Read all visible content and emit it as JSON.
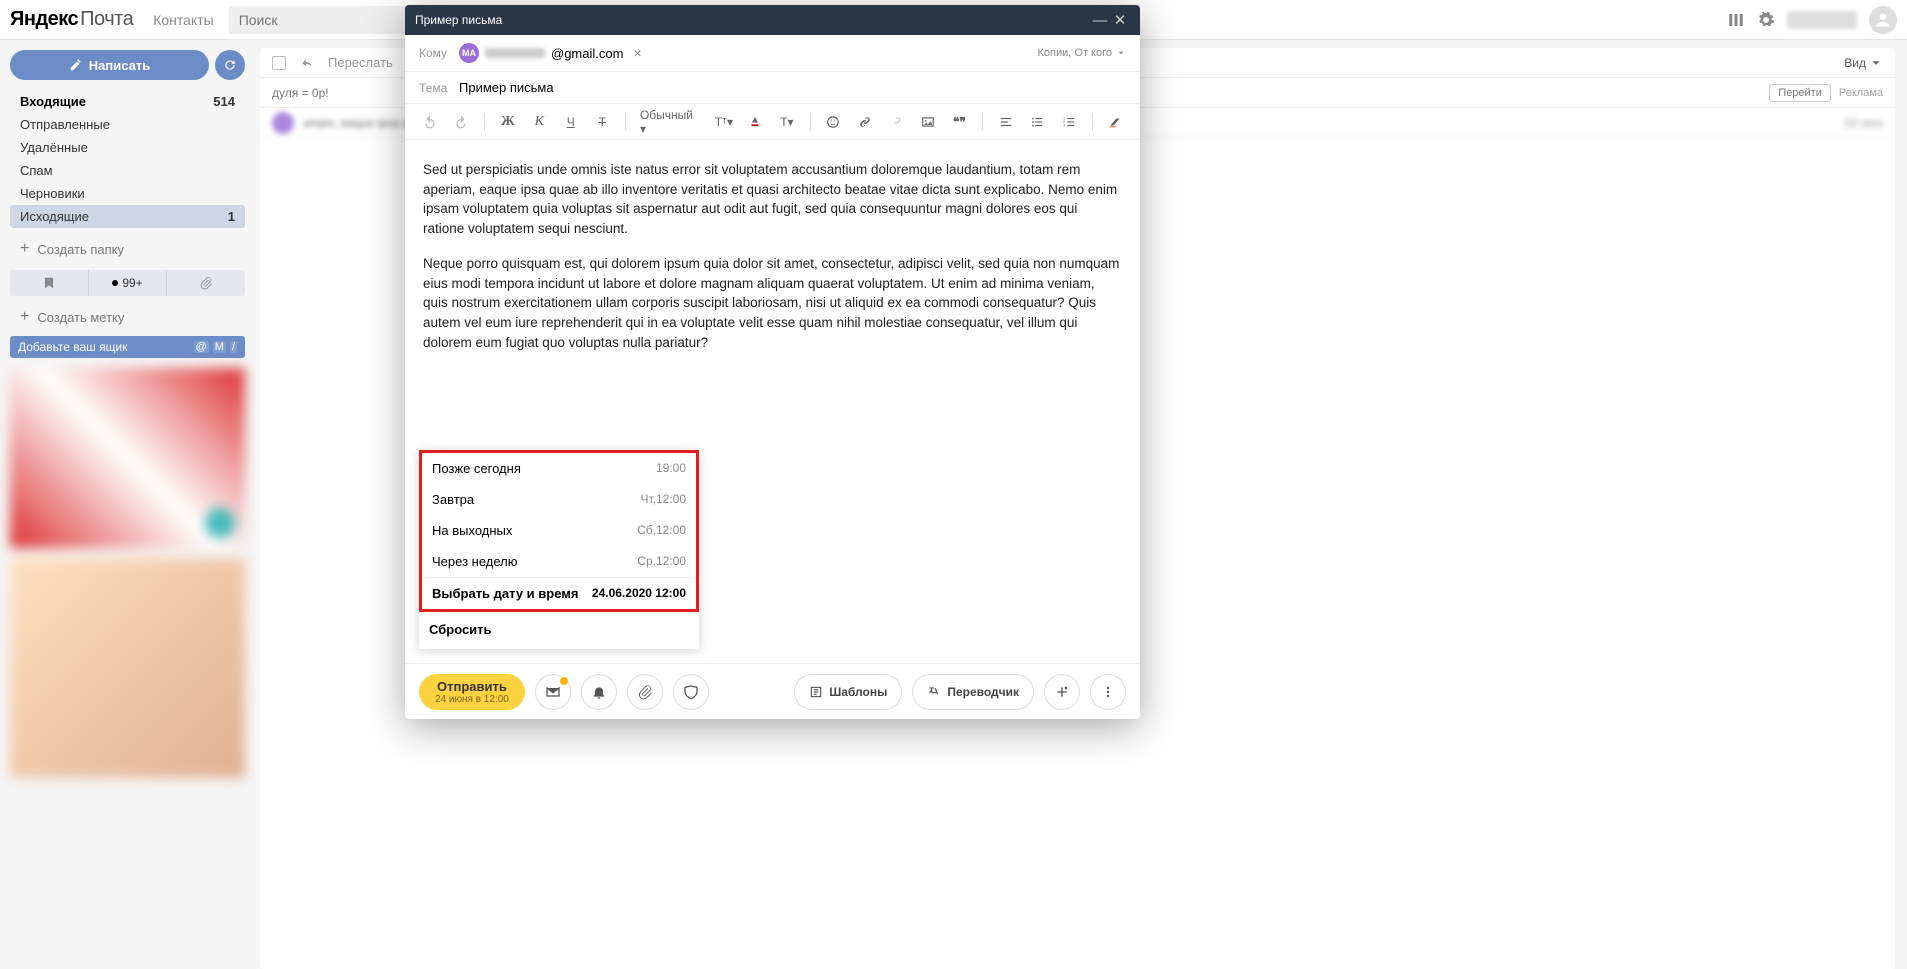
{
  "top": {
    "logo_ya": "Яндекс",
    "logo_sub": "Почта",
    "contacts": "Контакты",
    "search_placeholder": "Поиск"
  },
  "sidebar": {
    "compose": "Написать",
    "folders": [
      {
        "label": "Входящие",
        "count": "514",
        "bold": true,
        "sel": false
      },
      {
        "label": "Отправленные",
        "count": "",
        "bold": false,
        "sel": false
      },
      {
        "label": "Удалённые",
        "count": "",
        "bold": false,
        "sel": false
      },
      {
        "label": "Спам",
        "count": "",
        "bold": false,
        "sel": false
      },
      {
        "label": "Черновики",
        "count": "",
        "bold": false,
        "sel": false
      },
      {
        "label": "Исходящие",
        "count": "1",
        "bold": false,
        "sel": true
      }
    ],
    "create_folder": "Создать папку",
    "unread_badge": "99+",
    "create_label": "Создать метку",
    "add_box": "Добавьте ваш ящик",
    "add_box_icons": [
      "@",
      "M",
      "/"
    ]
  },
  "list": {
    "forward": "Переслать",
    "view": "Вид",
    "promo_text": "дуля = 0р!",
    "promo_go": "Перейти",
    "promo_ad": "Реклама",
    "msg_preview": "eriam, eaque ipsa quae ab illo inventore veritatis et quasi architecto b...",
    "msg_date": "24 июн"
  },
  "compose": {
    "title": "Пример письма",
    "to_label": "Кому",
    "to_initials": "MA",
    "to_suffix": "@gmail.com",
    "cc_label": "Копии, От кого",
    "subject_label": "Тема",
    "subject_value": "Пример письма",
    "style_normal": "Обычный",
    "body_p1": "Sed ut perspiciatis unde omnis iste natus error sit voluptatem accusantium doloremque laudantium, totam rem aperiam, eaque ipsa quae ab illo inventore veritatis et quasi architecto beatae vitae dicta sunt explicabo. Nemo enim ipsam voluptatem quia voluptas sit aspernatur aut odit aut fugit, sed quia consequuntur magni dolores eos qui ratione voluptatem sequi nesciunt.",
    "body_p2": "Neque porro quisquam est, qui dolorem ipsum quia dolor sit amet, consectetur, adipisci velit, sed quia non numquam eius modi tempora incidunt ut labore et dolore magnam aliquam quaerat voluptatem. Ut enim ad minima veniam, quis nostrum exercitationem ullam corporis suscipit laboriosam, nisi ut aliquid ex ea commodi consequatur? Quis autem vel eum iure reprehenderit qui in ea voluptate velit esse quam nihil molestiae consequatur, vel illum qui dolorem eum fugiat quo voluptas nulla pariatur?"
  },
  "schedule": {
    "rows": [
      {
        "label": "Позже сегодня",
        "time": "19:00"
      },
      {
        "label": "Завтра",
        "time": "Чт,12:00"
      },
      {
        "label": "На выходных",
        "time": "Сб,12:00"
      },
      {
        "label": "Через неделю",
        "time": "Ср,12:00"
      }
    ],
    "pick_label": "Выбрать дату и время",
    "pick_time": "24.06.2020 12:00",
    "reset": "Сбросить"
  },
  "footer": {
    "send": "Отправить",
    "send_sub": "24 июня в 12:00",
    "templates": "Шаблоны",
    "translator": "Переводчик"
  }
}
